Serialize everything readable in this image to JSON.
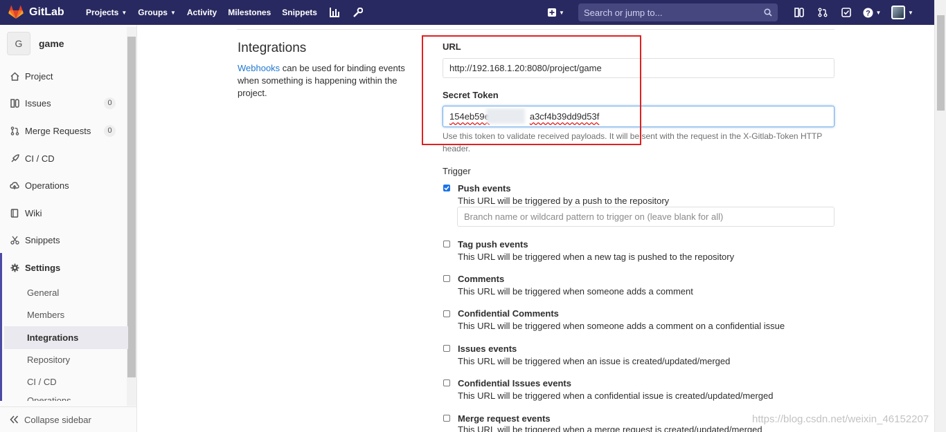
{
  "navbar": {
    "brand": "GitLab",
    "items": [
      {
        "label": "Projects",
        "dropdown": true
      },
      {
        "label": "Groups",
        "dropdown": true
      },
      {
        "label": "Activity"
      },
      {
        "label": "Milestones"
      },
      {
        "label": "Snippets"
      }
    ],
    "icons": [
      "chart-icon",
      "wrench-icon"
    ],
    "search_placeholder": "Search or jump to...",
    "right_icons": [
      "plus-icon",
      "issues-icon",
      "merge-request-icon",
      "todo-icon",
      "help-icon",
      "avatar-icon"
    ]
  },
  "sidebar": {
    "project_initial": "G",
    "project_name": "game",
    "items": [
      {
        "label": "Project",
        "icon": "home-icon"
      },
      {
        "label": "Issues",
        "icon": "issues-icon",
        "count": "0"
      },
      {
        "label": "Merge Requests",
        "icon": "merge-request-icon",
        "count": "0"
      },
      {
        "label": "CI / CD",
        "icon": "rocket-icon"
      },
      {
        "label": "Operations",
        "icon": "cloud-icon"
      },
      {
        "label": "Wiki",
        "icon": "book-icon"
      },
      {
        "label": "Snippets",
        "icon": "scissors-icon"
      },
      {
        "label": "Settings",
        "icon": "gear-icon"
      }
    ],
    "settings_sub": [
      "General",
      "Members",
      "Integrations",
      "Repository",
      "CI / CD",
      "Operations"
    ],
    "collapse": "Collapse sidebar"
  },
  "main": {
    "title": "Integrations",
    "desc_link": "Webhooks",
    "desc_text": " can be used for binding events when something is happening within the project.",
    "url_label": "URL",
    "url_value": "http://192.168.1.20:8080/project/game",
    "token_label": "Secret Token",
    "token_prefix": "154eb59e",
    "token_suffix": "a3cf4b39dd9d53f",
    "token_help": "Use this token to validate received payloads. It will be sent with the request in the X-Gitlab-Token HTTP header.",
    "trigger_label": "Trigger",
    "branch_placeholder": "Branch name or wildcard pattern to trigger on (leave blank for all)",
    "events": [
      {
        "title": "Push events",
        "desc": "This URL will be triggered by a push to the repository",
        "checked": true
      },
      {
        "title": "Tag push events",
        "desc": "This URL will be triggered when a new tag is pushed to the repository",
        "checked": false
      },
      {
        "title": "Comments",
        "desc": "This URL will be triggered when someone adds a comment",
        "checked": false
      },
      {
        "title": "Confidential Comments",
        "desc": "This URL will be triggered when someone adds a comment on a confidential issue",
        "checked": false
      },
      {
        "title": "Issues events",
        "desc": "This URL will be triggered when an issue is created/updated/merged",
        "checked": false
      },
      {
        "title": "Confidential Issues events",
        "desc": "This URL will be triggered when a confidential issue is created/updated/merged",
        "checked": false
      },
      {
        "title": "Merge request events",
        "desc": "This URL will be triggered when a merge request is created/updated/merged",
        "checked": false
      }
    ]
  },
  "watermark": "https://blog.csdn.net/weixin_46152207",
  "colors": {
    "navbar": "#292961",
    "accent": "#4b4ba3",
    "link": "#1f78d1",
    "highlight": "#e02020"
  }
}
